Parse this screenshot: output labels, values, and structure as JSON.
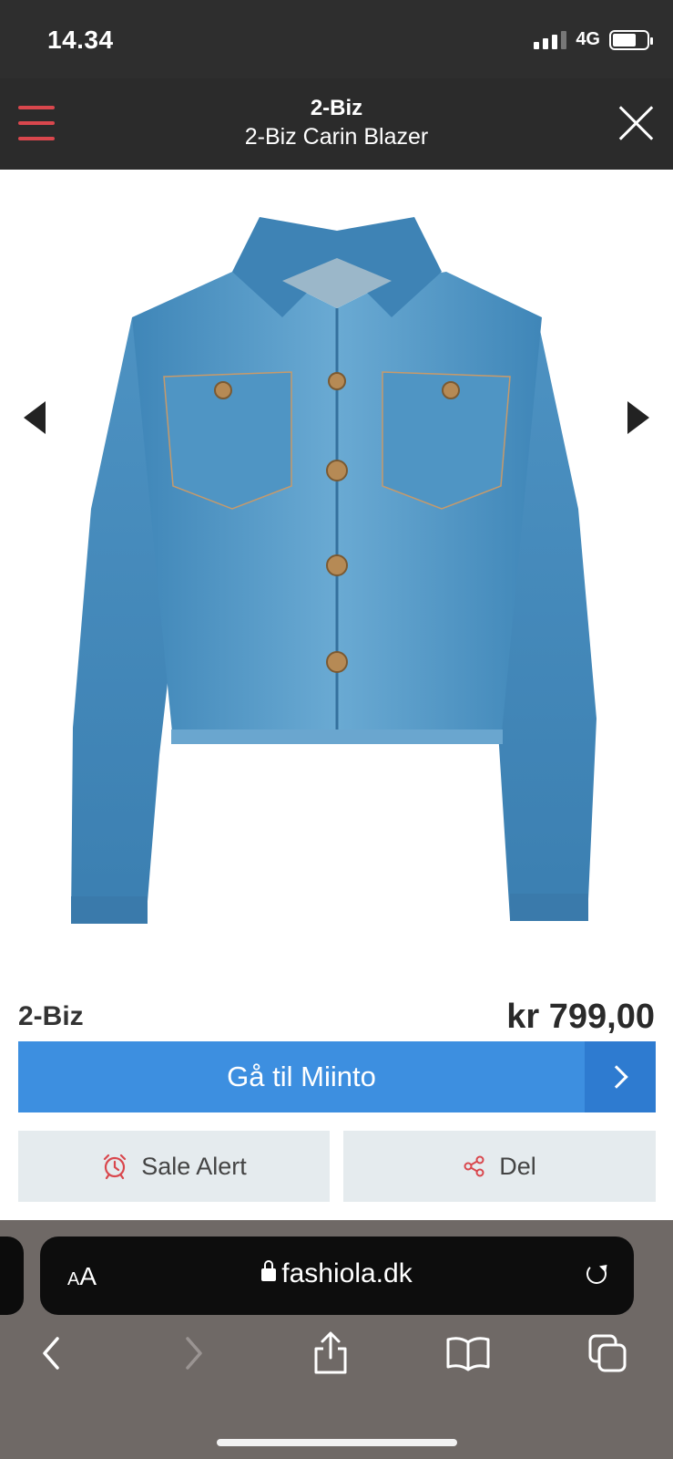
{
  "status_bar": {
    "time": "14.34",
    "network": "4G"
  },
  "header": {
    "brand": "2-Biz",
    "product_name": "2-Biz Carin Blazer"
  },
  "product": {
    "brand": "2-Biz",
    "price": "kr 799,00",
    "image_subject": "blue denim jacket"
  },
  "cta": {
    "label": "Gå til Miinto"
  },
  "actions": {
    "sale_alert_label": "Sale Alert",
    "share_label": "Del"
  },
  "browser": {
    "text_size_label_small": "A",
    "text_size_label_large": "A",
    "url": "fashiola.dk"
  },
  "colors": {
    "header_bg": "#2b2b2b",
    "menu_accent": "#d9474d",
    "cta_blue": "#3d8fe0",
    "action_bg": "#e5ebee",
    "browser_bg": "#6f6966"
  }
}
